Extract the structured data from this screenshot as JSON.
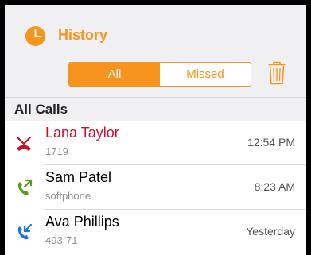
{
  "header": {
    "title": "History"
  },
  "segments": {
    "all": "All",
    "missed": "Missed",
    "selected": "All"
  },
  "section": {
    "title": "All Calls"
  },
  "calls": [
    {
      "name": "Lana Taylor",
      "detail": "1719",
      "time": "12:54 PM",
      "type": "missed",
      "name_color": "#c8102e",
      "icon": "missed-call-icon"
    },
    {
      "name": "Sam Patel",
      "detail": "softphone",
      "time": "8:23 AM",
      "type": "outgoing",
      "name_color": "#000000",
      "icon": "outgoing-call-icon"
    },
    {
      "name": "Ava Phillips",
      "detail": "493-71",
      "time": "Yesterday",
      "type": "incoming",
      "name_color": "#000000",
      "icon": "incoming-call-icon"
    }
  ],
  "colors": {
    "accent": "#f7941d",
    "missed": "#c8102e",
    "outgoing": "#5a9a1f",
    "incoming": "#1a73e8"
  }
}
